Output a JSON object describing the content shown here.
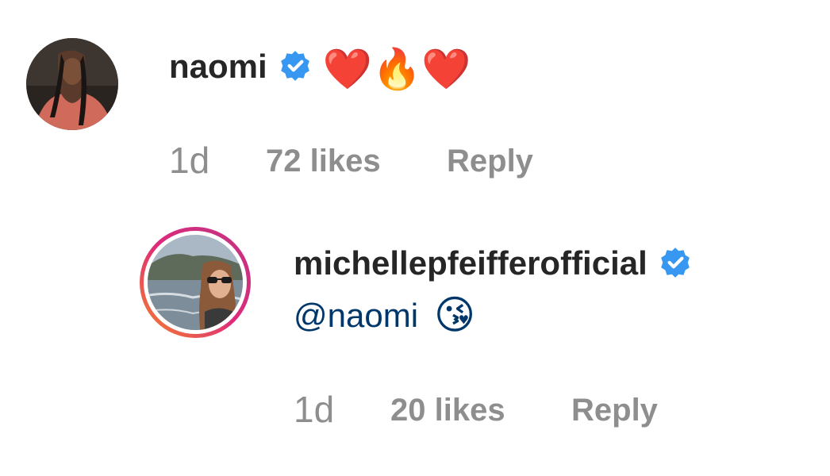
{
  "comments": [
    {
      "username": "naomi",
      "text": "❤️🔥❤️",
      "time": "1d",
      "likes": "72 likes",
      "reply_label": "Reply"
    },
    {
      "username": "michellepfeifferofficial",
      "mention": "@naomi",
      "text": "😘",
      "time": "1d",
      "likes": "20 likes",
      "reply_label": "Reply"
    }
  ],
  "colors": {
    "username": "#262626",
    "meta": "#8e8e8e",
    "mention": "#00376b",
    "verified": "#3897f0"
  }
}
